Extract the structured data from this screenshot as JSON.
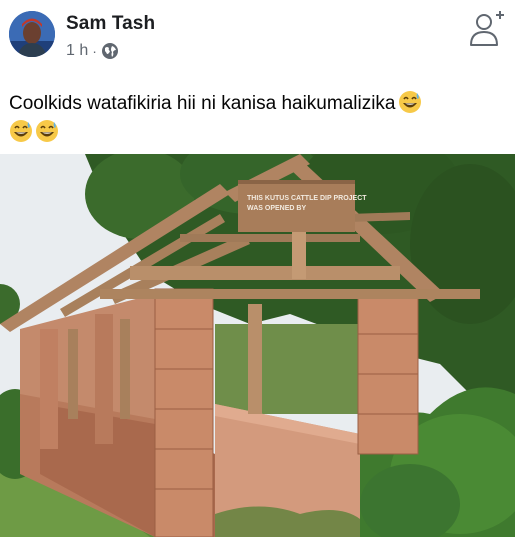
{
  "post": {
    "author": "Sam Tash",
    "time": "1 h",
    "separator": "·",
    "privacy_icon": "globe-icon",
    "text_line1": "Coolkids watafikiria hii ni kanisa haikumalizika",
    "emoji": "grinning-sweat-emoji",
    "photo": {
      "sign_text_line1": "THIS KUTUS CATTLE DIP PROJECT",
      "sign_text_line2": "WAS OPENED BY"
    }
  },
  "header": {
    "add_friend_icon": "add-friend-icon"
  },
  "colors": {
    "name": "#1c1e21",
    "meta": "#606770",
    "text": "#050505",
    "wall": "#c4876a",
    "wood": "#b98f6a",
    "foliage": "#3e6b2a"
  }
}
